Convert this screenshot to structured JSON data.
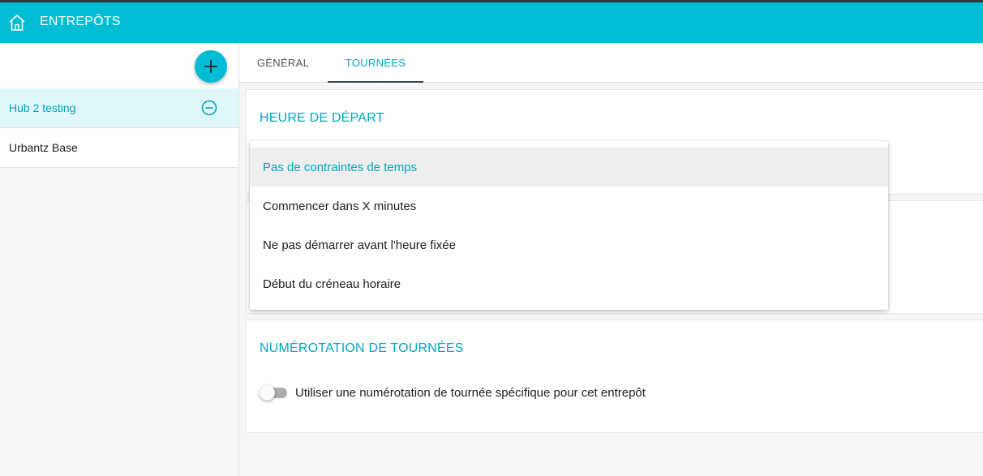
{
  "appbar": {
    "title": "ENTREPÔTS",
    "home_icon": "home-icon"
  },
  "colors": {
    "accent": "#00bcd4",
    "accent_text": "#00a7bf",
    "selected_bg": "#e0f7fa"
  },
  "sidebar": {
    "add_icon": "plus-icon",
    "items": [
      {
        "label": "Hub 2 testing",
        "active": true,
        "action_icon": "minus-circle-icon"
      },
      {
        "label": "Urbantz Base",
        "active": false
      }
    ]
  },
  "tabs": [
    {
      "label": "GÉNÉRAL",
      "active": false
    },
    {
      "label": "TOURNÉES",
      "active": true
    }
  ],
  "departure": {
    "title": "HEURE DE DÉPART",
    "options": [
      "Pas de contraintes de temps",
      "Commencer dans X minutes",
      "Ne pas démarrer avant l'heure fixée",
      "Début du créneau horaire"
    ],
    "selected": "Pas de contraintes de temps"
  },
  "numbering": {
    "title": "NUMÉROTATION DE TOURNÉES",
    "toggle_label": "Utiliser une numérotation de tournée spécifique pour cet entrepôt",
    "toggle_on": false
  }
}
